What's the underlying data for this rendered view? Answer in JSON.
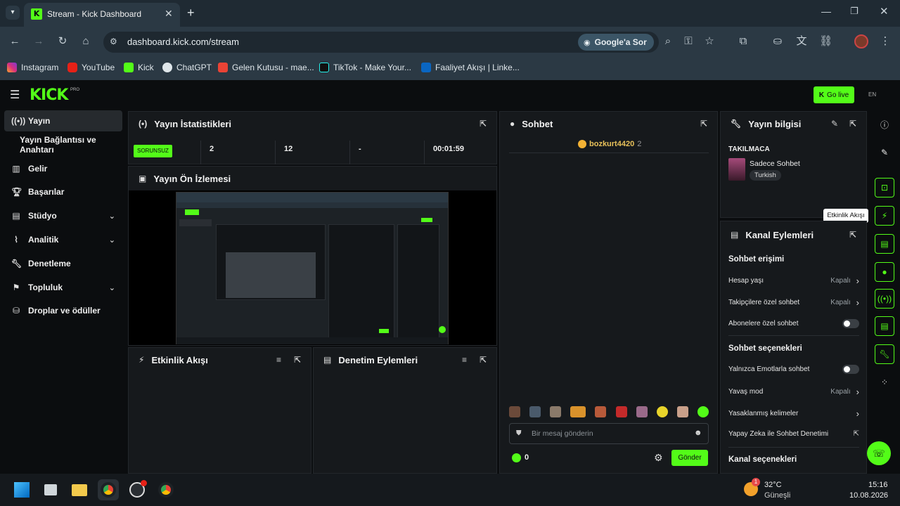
{
  "browser": {
    "tab_title": "Stream - Kick Dashboard",
    "new_tab": "+",
    "url": "dashboard.kick.com/stream",
    "google_ask": "Google'a Sor",
    "bookmarks": [
      "Instagram",
      "YouTube",
      "Kick",
      "ChatGPT",
      "Gelen Kutusu - mae...",
      "TikTok - Make Your...",
      "Faaliyet Akışı | Linke..."
    ]
  },
  "app": {
    "logo": "KICK",
    "go_live": "Go live"
  },
  "sidebar": {
    "items": [
      {
        "label": "Yayın",
        "icon": "broadcast-icon",
        "active": true
      },
      {
        "label": "Yayın Bağlantısı ve Anahtarı",
        "icon": "",
        "active": false
      },
      {
        "label": "Gelir",
        "icon": "chart-icon",
        "active": false
      },
      {
        "label": "Başarılar",
        "icon": "trophy-icon",
        "active": false
      },
      {
        "label": "Stüdyo",
        "icon": "studio-icon",
        "active": false,
        "chevron": true
      },
      {
        "label": "Analitik",
        "icon": "analytics-icon",
        "active": false,
        "chevron": true
      },
      {
        "label": "Denetleme",
        "icon": "wrench-icon",
        "active": false
      },
      {
        "label": "Topluluk",
        "icon": "community-icon",
        "active": false,
        "chevron": true
      },
      {
        "label": "Droplar ve ödüller",
        "icon": "drops-icon",
        "active": false
      }
    ]
  },
  "stats": {
    "title": "Yayın İstatistikleri",
    "status": "SORUNSUZ",
    "cells": [
      "2",
      "12",
      "-",
      "00:01:59"
    ]
  },
  "preview": {
    "title": "Yayın Ön İzlemesi"
  },
  "event_feed": {
    "title": "Etkinlik Akışı"
  },
  "mod_actions": {
    "title": "Denetim Eylemleri"
  },
  "chat": {
    "title": "Sohbet",
    "viewer_name": "bozkurt4420",
    "viewer_count": "2",
    "placeholder": "Bir mesaj gönderin",
    "points": "0",
    "send": "Gönder"
  },
  "stream_info": {
    "title": "Yayın bilgisi",
    "category": "TAKILMACA",
    "stream_title": "Sadece Sohbet",
    "language": "Turkish"
  },
  "tooltip": "Etkinlik Akışı",
  "channel_actions": {
    "title": "Kanal Eylemleri",
    "section_access": "Sohbet erişimi",
    "account_age": {
      "label": "Hesap yaşı",
      "value": "Kapalı"
    },
    "followers_only": {
      "label": "Takipçilere özel sohbet",
      "value": "Kapalı"
    },
    "subscribers_only": {
      "label": "Abonelere özel sohbet"
    },
    "section_options": "Sohbet seçenekleri",
    "emote_only": {
      "label": "Yalnızca Emotlarla sohbet"
    },
    "slow_mode": {
      "label": "Yavaş mod",
      "value": "Kapalı"
    },
    "banned_words": {
      "label": "Yasaklanmış kelimeler"
    },
    "ai_moderation": {
      "label": "Yapay Zeka ile Sohbet Denetimi"
    },
    "section_channel": "Kanal seçenekleri"
  },
  "taskbar": {
    "temperature": "32°C",
    "weather": "Güneşli",
    "time": "15:16",
    "date": "10.08.2026",
    "badge": "1"
  },
  "colors": {
    "accent": "#53fc18",
    "bg": "#0b0d0f",
    "panel": "#16191c"
  }
}
